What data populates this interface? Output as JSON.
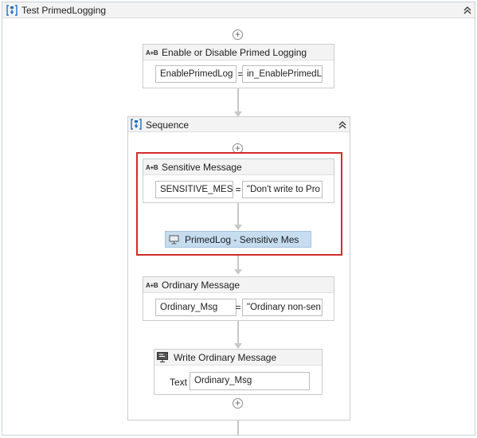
{
  "workflow": {
    "title": "Test PrimedLogging"
  },
  "enable_assign": {
    "title": "Enable or Disable Primed Logging",
    "icon": "A+B",
    "to": "EnablePrimedLog",
    "equals": "=",
    "value": "in_EnablePrimedLo"
  },
  "sequence": {
    "title": "Sequence"
  },
  "sensitive_assign": {
    "title": "Sensitive Message",
    "icon": "A+B",
    "to": "SENSITIVE_MESSAG",
    "equals": "=",
    "value": "\"Don't write to Pro"
  },
  "primed_log": {
    "label": "PrimedLog - Sensitive Mes"
  },
  "ordinary_assign": {
    "title": "Ordinary Message",
    "icon": "A+B",
    "to": "Ordinary_Msg",
    "equals": "=",
    "value": "\"Ordinary non-sen"
  },
  "write_line": {
    "title": "Write Ordinary Message",
    "text_label": "Text",
    "text_value": "Ordinary_Msg"
  },
  "colors": {
    "selection": "#d32a2a",
    "primedlog_fill": "#c6dcef",
    "connector": "#c8c8c8"
  }
}
